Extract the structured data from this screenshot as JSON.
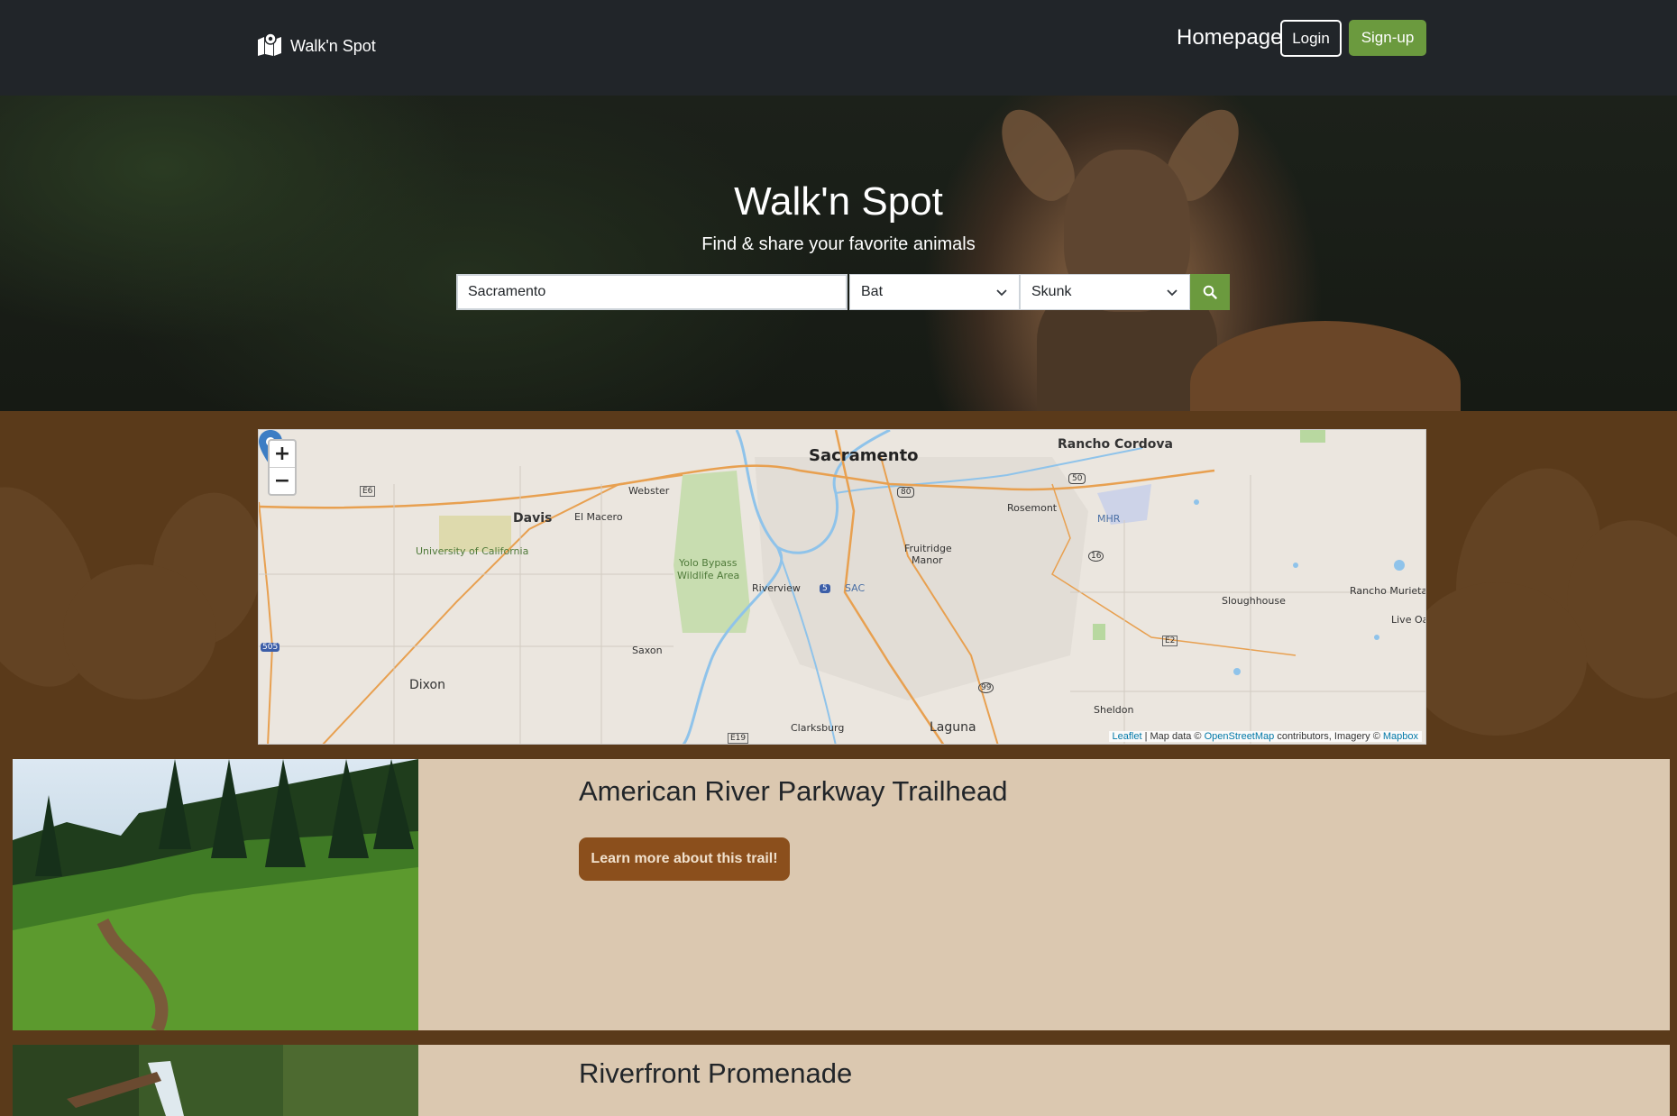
{
  "navbar": {
    "brand": "Walk'n Spot",
    "brand_icon": "map-pin-icon",
    "homepage": "Homepage",
    "login": "Login",
    "signup": "Sign-up"
  },
  "hero": {
    "title": "Walk'n Spot",
    "subtitle": "Find & share your favorite animals",
    "search_value": "Sacramento",
    "select1": "Bat",
    "select2": "Skunk",
    "search_icon": "search-icon"
  },
  "map": {
    "zoom_in": "+",
    "zoom_out": "−",
    "labels": {
      "sacramento": "Sacramento",
      "rancho_cordova": "Rancho Cordova",
      "davis": "Davis",
      "el_macero": "El Macero",
      "webster": "Webster",
      "uc": "University of California",
      "yolo1": "Yolo Bypass",
      "yolo2": "Wildlife Area",
      "riverview": "Riverview",
      "sac": "SAC",
      "fruitridge1": "Fruitridge",
      "fruitridge2": "Manor",
      "rosemont": "Rosemont",
      "mhr": "MHR",
      "sloughhouse": "Sloughhouse",
      "rancho_murieta": "Rancho Murieta",
      "live_oak": "Live Oak",
      "saxon": "Saxon",
      "dixon": "Dixon",
      "sheldon": "Sheldon",
      "clarksburg": "Clarksburg",
      "laguna": "Laguna",
      "e6": "E6",
      "e2": "E2",
      "e19": "E19",
      "r80": "80",
      "r50": "50",
      "r16": "16",
      "r99": "99",
      "r5": "5",
      "r505": "505"
    },
    "attribution": {
      "leaflet": "Leaflet",
      "text1": " | Map data © ",
      "osm": "OpenStreetMap",
      "text2": " contributors, Imagery © ",
      "mapbox": "Mapbox"
    }
  },
  "trails": [
    {
      "name": "American River Parkway Trailhead",
      "button": "Learn more about this trail!"
    },
    {
      "name": "Riverfront Promenade"
    }
  ]
}
